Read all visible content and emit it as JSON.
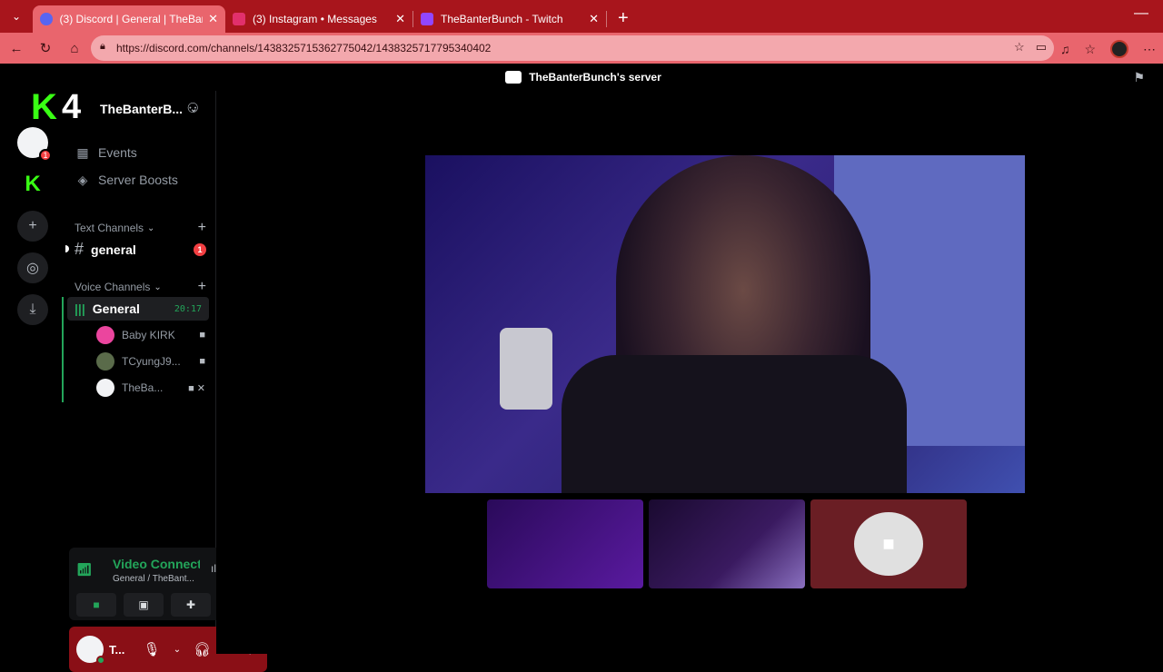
{
  "browser": {
    "tabs": [
      {
        "title": "(3) Discord | General | TheBan",
        "color": "#5865f2"
      },
      {
        "title": "(3) Instagram • Messages",
        "color": "#e1306c"
      },
      {
        "title": "TheBanterBunch - Twitch",
        "color": "#9146ff"
      }
    ],
    "url": "https://discord.com/channels/1438325715362775042/1438325717795340402"
  },
  "app": {
    "title": "TheBanterBunch's server"
  },
  "server": {
    "header_name": "TheBanterB...",
    "overlay_number": "4",
    "menu": [
      {
        "label": "Events",
        "icon": "calendar-icon"
      },
      {
        "label": "Server Boosts",
        "icon": "boost-icon"
      }
    ],
    "text_category": "Text Channels",
    "text_channels": [
      {
        "name": "general",
        "mentions": "1"
      }
    ],
    "voice_category": "Voice Channels",
    "voice_channel": {
      "name": "General",
      "timer": "20:17",
      "users": [
        {
          "name": "Baby KIRK",
          "color": "#eb459e"
        },
        {
          "name": "TCyungJ9...",
          "color": "#5a6b4a"
        },
        {
          "name": "TheBa...",
          "color": "#f2f3f5"
        }
      ]
    }
  },
  "guild_badges": {
    "server": "1"
  },
  "voice_panel": {
    "status": "Video Connecte",
    "channel": "General / TheBant..."
  },
  "user_bar": {
    "name": "T..."
  }
}
